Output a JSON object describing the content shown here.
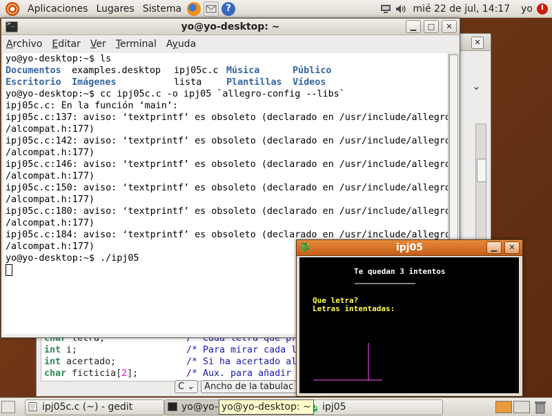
{
  "top_panel": {
    "menus": [
      "Aplicaciones",
      "Lugares",
      "Sistema"
    ],
    "clock": "mié 22 de jul, 14:17",
    "user": "yo",
    "launchers": [
      "firefox-icon",
      "mail-icon",
      "help-icon"
    ]
  },
  "gedit": {
    "code_lines": [
      {
        "kw": "char",
        "rest": " letra;",
        "comment": "/* Cada letra que pr"
      },
      {
        "kw": "int",
        "rest": " i;",
        "comment": "/* Para mirar cada l"
      },
      {
        "kw": "int",
        "rest": " acertado;",
        "comment": "/* Si ha acertado al"
      },
      {
        "kw": "char",
        "rest": " ficticia[",
        "num": "2",
        "rest2": "];",
        "comment": "/* Aux. para añadir"
      }
    ],
    "status_combo": "C",
    "status_tab": "Ancho de la tabulac"
  },
  "terminal": {
    "title": "yo@yo-desktop: ~",
    "menus": [
      "Archivo",
      "Editar",
      "Ver",
      "Terminal",
      "Ayuda"
    ],
    "menu_accels": [
      "A",
      "E",
      "V",
      "T",
      "y"
    ],
    "lines": [
      "yo@yo-desktop:~$ ls",
      "__LS1__",
      "__LS2__",
      "yo@yo-desktop:~$ cc ipj05c.c -o ipj05 `allegro-config --libs`",
      "ipj05c.c: En la función ‘main’:",
      "ipj05c.c:137: aviso: ‘textprintf’ es obsoleto (declarado en /usr/include/allegro",
      "/alcompat.h:177)",
      "ipj05c.c:142: aviso: ‘textprintf’ es obsoleto (declarado en /usr/include/allegro",
      "/alcompat.h:177)",
      "ipj05c.c:146: aviso: ‘textprintf’ es obsoleto (declarado en /usr/include/allegro",
      "/alcompat.h:177)",
      "ipj05c.c:150: aviso: ‘textprintf’ es obsoleto (declarado en /usr/include/allegro",
      "/alcompat.h:177)",
      "ipj05c.c:180: aviso: ‘textprintf’ es obsoleto (declarado en /usr/include/allegro",
      "/alcompat.h:177)",
      "ipj05c.c:184: aviso: ‘textprintf’ es obsoleto (declarado en /usr/include/allegro",
      "/alcompat.h:177)",
      "yo@yo-desktop:~$ ./ipj05"
    ],
    "ls_row1": [
      {
        "text": "Documentos",
        "dir": true
      },
      {
        "text": "examples.desktop",
        "dir": false
      },
      {
        "text": "ipj05c.c",
        "dir": false
      },
      {
        "text": "Música",
        "dir": true
      },
      {
        "text": "Público",
        "dir": true
      }
    ],
    "ls_row2": [
      {
        "text": "Escritorio",
        "dir": true
      },
      {
        "text": "Imágenes",
        "dir": true
      },
      {
        "text": "lista",
        "dir": false
      },
      {
        "text": "Plantillas",
        "dir": true
      },
      {
        "text": "Vídeos",
        "dir": true
      }
    ]
  },
  "allegro": {
    "title": "ipj05",
    "tries_text": "Te quedan 3 intentos",
    "prompt": "Que letra?",
    "tried_label": "Letras intentadas:",
    "colors": {
      "tries": "#ffffff",
      "prompt": "#ffff54",
      "gallows": "#ff54ff"
    }
  },
  "taskbar": {
    "tasks": [
      "ipj05c.c (~) - gedit",
      "yo@yo-desktop: ~",
      "ipj05"
    ],
    "tooltip": "yo@yo-desktop: ~"
  }
}
